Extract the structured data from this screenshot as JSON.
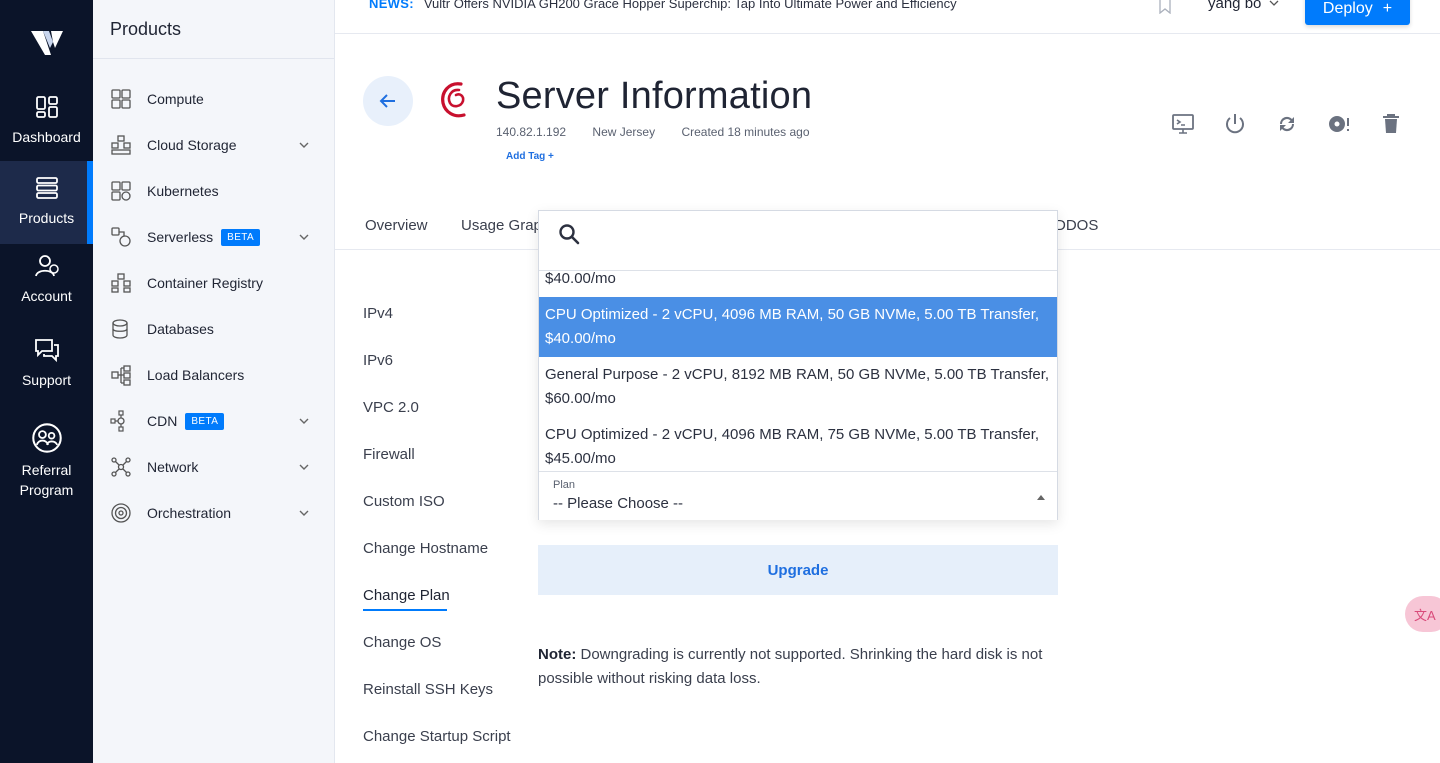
{
  "rail": {
    "items": [
      {
        "label": "Dashboard",
        "icon": "dashboard-icon"
      },
      {
        "label": "Products",
        "icon": "products-icon"
      },
      {
        "label": "Account",
        "icon": "account-icon"
      },
      {
        "label": "Support",
        "icon": "support-icon"
      },
      {
        "label": "Referral",
        "label2": "Program",
        "icon": "referral-icon"
      }
    ]
  },
  "sidebar": {
    "title": "Products",
    "items": [
      {
        "label": "Compute"
      },
      {
        "label": "Cloud Storage"
      },
      {
        "label": "Kubernetes"
      },
      {
        "label": "Serverless",
        "badge": "BETA"
      },
      {
        "label": "Container Registry"
      },
      {
        "label": "Databases"
      },
      {
        "label": "Load Balancers"
      },
      {
        "label": "CDN",
        "badge": "BETA"
      },
      {
        "label": "Network"
      },
      {
        "label": "Orchestration"
      }
    ]
  },
  "topbar": {
    "news_label": "NEWS:",
    "news_text": "Vultr Offers NVIDIA GH200 Grace Hopper Superchip: Tap Into Ultimate Power and Efficiency",
    "user": "yang bo",
    "deploy_label": "Deploy",
    "deploy_plus": "+"
  },
  "server": {
    "title": "Server Information",
    "ip": "140.82.1.192",
    "location": "New Jersey",
    "created": "Created 18 minutes ago",
    "add_tag": "Add Tag +"
  },
  "tabs": {
    "overview": "Overview",
    "usage": "Usage Grap",
    "ddos": "DDOS"
  },
  "settings_menu": [
    "IPv4",
    "IPv6",
    "VPC 2.0",
    "Firewall",
    "Custom ISO",
    "Change Hostname",
    "Change Plan",
    "Change OS",
    "Reinstall SSH Keys",
    "Change Startup Script"
  ],
  "plan_dropdown": {
    "search_placeholder": "",
    "options": [
      {
        "line1": "$40.00/mo",
        "line2": ""
      },
      {
        "line1": "CPU Optimized - 2 vCPU, 4096 MB RAM, 50 GB NVMe, 5.00 TB Transfer,",
        "line2": "$40.00/mo",
        "selected": true
      },
      {
        "line1": "General Purpose - 2 vCPU, 8192 MB RAM, 50 GB NVMe, 5.00 TB Transfer,",
        "line2": "$60.00/mo"
      },
      {
        "line1": "CPU Optimized - 2 vCPU, 4096 MB RAM, 75 GB NVMe, 5.00 TB Transfer,",
        "line2": "$45.00/mo"
      }
    ],
    "field_label": "Plan",
    "field_value": "-- Please Choose --"
  },
  "upgrade_label": "Upgrade",
  "note": {
    "bold": "Note:",
    "text": " Downgrading is currently not supported. Shrinking the hard disk is not possible without risking data loss."
  },
  "colors": {
    "accent": "#007bfc",
    "rail_bg": "#0b1429",
    "selected_option": "#4a8fe5"
  }
}
